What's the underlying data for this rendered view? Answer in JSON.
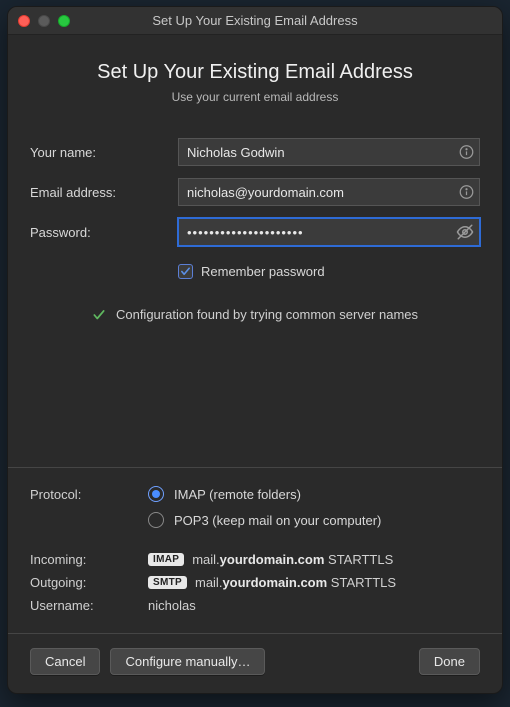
{
  "window": {
    "title": "Set Up Your Existing Email Address"
  },
  "header": {
    "title": "Set Up Your Existing Email Address",
    "subtitle": "Use your current email address"
  },
  "form": {
    "name_label": "Your name:",
    "name_value": "Nicholas Godwin",
    "email_label": "Email address:",
    "email_value": "nicholas@yourdomain.com",
    "password_label": "Password:",
    "password_mask": "•••••••••••••••••••••",
    "remember_label": "Remember password"
  },
  "status": {
    "message": "Configuration found by trying common server names"
  },
  "config": {
    "protocol_label": "Protocol:",
    "imap_label": "IMAP (remote folders)",
    "pop3_label": "POP3 (keep mail on your computer)",
    "incoming_label": "Incoming:",
    "incoming_badge": "IMAP",
    "incoming_host_prefix": "mail.",
    "incoming_host_bold": "yourdomain.com",
    "incoming_security": " STARTTLS",
    "outgoing_label": "Outgoing:",
    "outgoing_badge": "SMTP",
    "outgoing_host_prefix": "mail.",
    "outgoing_host_bold": "yourdomain.com",
    "outgoing_security": " STARTTLS",
    "username_label": "Username:",
    "username_value": "nicholas"
  },
  "buttons": {
    "cancel": "Cancel",
    "manual": "Configure manually…",
    "done": "Done"
  }
}
